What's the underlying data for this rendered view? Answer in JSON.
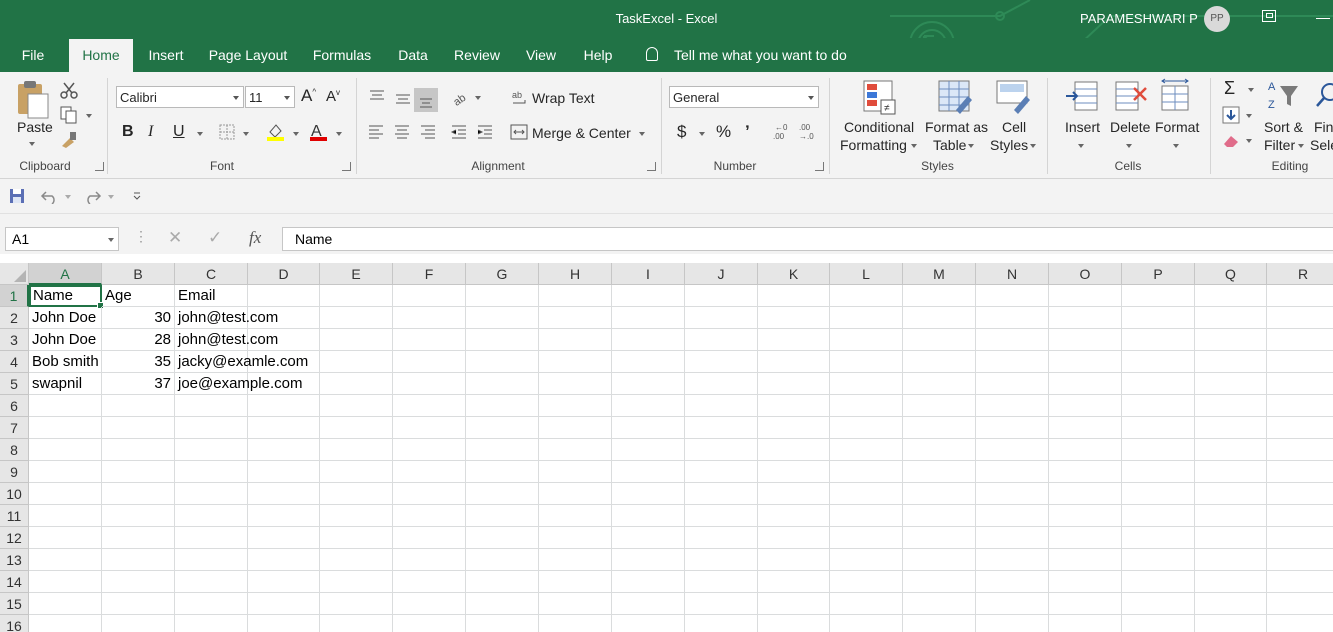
{
  "title_bar": {
    "title": "TaskExcel  -  Excel",
    "user_name": "PARAMESHWARI P",
    "user_initials": "PP",
    "accent": "#217346"
  },
  "tabs": [
    {
      "label": "File"
    },
    {
      "label": "Home"
    },
    {
      "label": "Insert"
    },
    {
      "label": "Page Layout"
    },
    {
      "label": "Formulas"
    },
    {
      "label": "Data"
    },
    {
      "label": "Review"
    },
    {
      "label": "View"
    },
    {
      "label": "Help"
    }
  ],
  "tell_me": "Tell me what you want to do",
  "ribbon": {
    "clipboard": {
      "paste": "Paste",
      "group": "Clipboard"
    },
    "font": {
      "name": "Calibri",
      "size": "11",
      "bold": "B",
      "italic": "I",
      "underline": "U",
      "group": "Font"
    },
    "alignment": {
      "wrap_text": "Wrap Text",
      "merge_center": "Merge & Center",
      "group": "Alignment"
    },
    "number": {
      "format": "General",
      "currency": "$",
      "percent": "%",
      "comma": "ʼ",
      "group": "Number"
    },
    "styles": {
      "conditional_1": "Conditional",
      "conditional_2": "Formatting",
      "format_table_1": "Format as",
      "format_table_2": "Table",
      "cell_styles_1": "Cell",
      "cell_styles_2": "Styles",
      "group": "Styles"
    },
    "cells": {
      "insert": "Insert",
      "delete": "Delete",
      "format": "Format",
      "group": "Cells"
    },
    "editing": {
      "sort_1": "Sort &",
      "sort_2": "Filter",
      "find_1": "Find",
      "find_2": "Select",
      "group": "Editing"
    }
  },
  "formula_bar": {
    "name_box": "A1",
    "fx": "fx",
    "value": "Name"
  },
  "sheet": {
    "columns": [
      "A",
      "B",
      "C",
      "D",
      "E",
      "F",
      "G",
      "H",
      "I",
      "J",
      "K",
      "L",
      "M",
      "N",
      "O",
      "P",
      "Q",
      "R"
    ],
    "rows": [
      "1",
      "2",
      "3",
      "4",
      "5",
      "6",
      "7",
      "8",
      "9",
      "10",
      "11",
      "12",
      "13",
      "14",
      "15",
      "16"
    ],
    "data": [
      [
        "Name",
        "Age",
        "Email"
      ],
      [
        "John Doe",
        "30",
        "john@test.com"
      ],
      [
        "John Doe",
        "28",
        "john@test.com"
      ],
      [
        "Bob smith",
        "35",
        "jacky@examle.com"
      ],
      [
        "swapnil",
        "37",
        "joe@example.com"
      ]
    ],
    "active_cell": "A1"
  }
}
